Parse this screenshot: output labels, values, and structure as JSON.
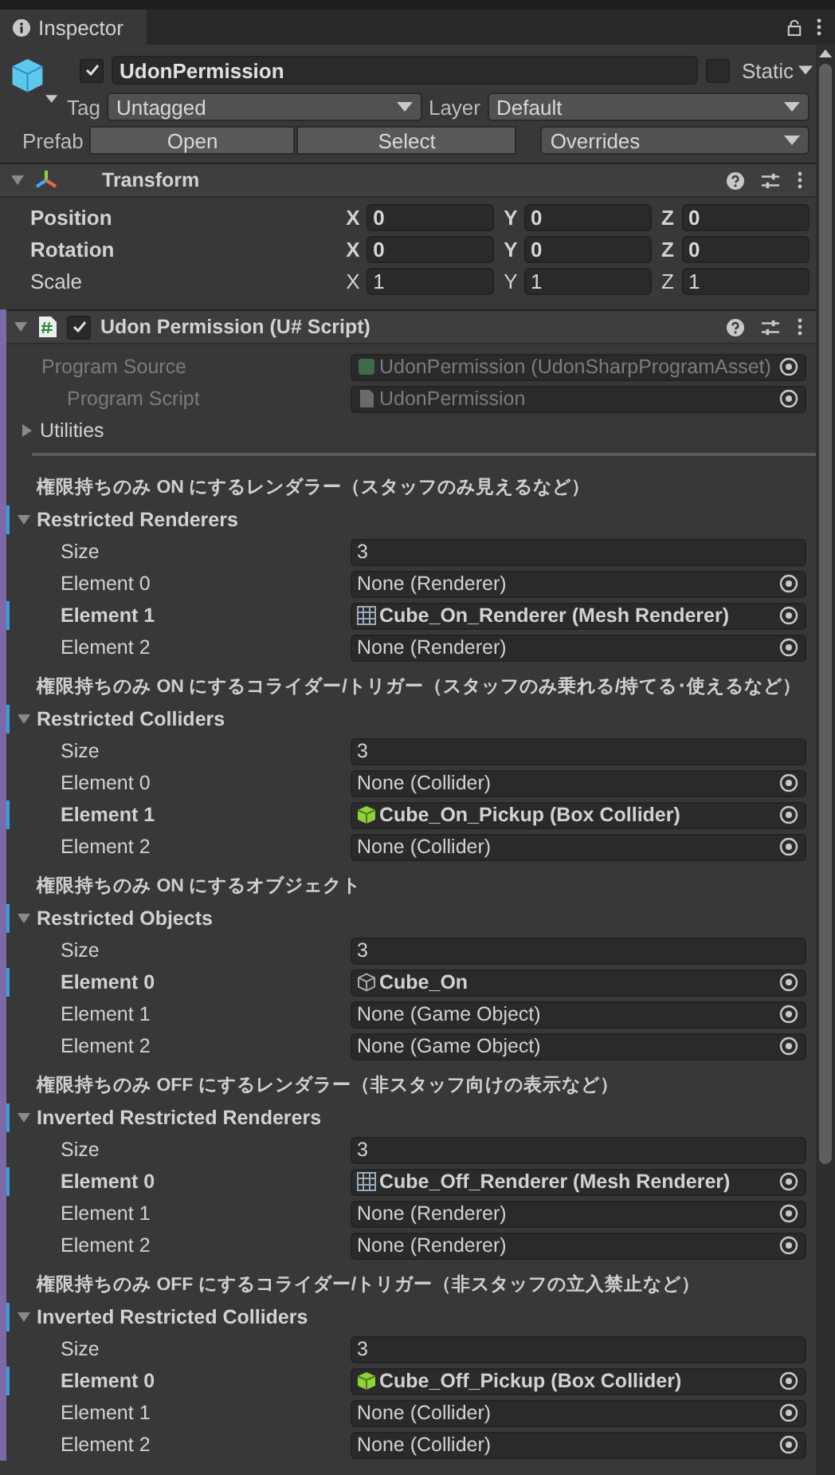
{
  "tab": {
    "title": "Inspector"
  },
  "object": {
    "enabled": true,
    "name": "UdonPermission",
    "static": false,
    "static_label": "Static",
    "tag_label": "Tag",
    "tag": "Untagged",
    "layer_label": "Layer",
    "layer": "Default",
    "prefab_label": "Prefab",
    "prefab_buttons": [
      "Open",
      "Select"
    ],
    "overrides": "Overrides"
  },
  "transform": {
    "title": "Transform",
    "expanded": true,
    "rows": [
      {
        "label": "Position",
        "modified": true,
        "values": [
          {
            "axis": "X",
            "value": "0"
          },
          {
            "axis": "Y",
            "value": "0"
          },
          {
            "axis": "Z",
            "value": "0"
          }
        ]
      },
      {
        "label": "Rotation",
        "modified": true,
        "values": [
          {
            "axis": "X",
            "value": "0"
          },
          {
            "axis": "Y",
            "value": "0"
          },
          {
            "axis": "Z",
            "value": "0"
          }
        ]
      },
      {
        "label": "Scale",
        "modified": false,
        "values": [
          {
            "axis": "X",
            "value": "1"
          },
          {
            "axis": "Y",
            "value": "1"
          },
          {
            "axis": "Z",
            "value": "1"
          }
        ]
      }
    ]
  },
  "script": {
    "title": "Udon Permission (U# Script)",
    "enabled": true,
    "expanded": true,
    "fields": [
      {
        "label": "Program Source",
        "value": "UdonPermission (UdonSharpProgramAsset)",
        "kind": "asset",
        "disabled": true,
        "children": [
          {
            "label": "Program Script",
            "value": "UdonPermission",
            "kind": "script",
            "disabled": true
          }
        ]
      }
    ],
    "utilities": {
      "label": "Utilities",
      "expanded": false
    }
  },
  "sections": [
    {
      "caption": "権限持ちのみ ON にするレンダラー（スタッフのみ見えるなど）",
      "title": "Restricted Renderers",
      "expanded": true,
      "modified": true,
      "size_label": "Size",
      "size": "3",
      "elements": [
        {
          "label": "Element 0",
          "value": "None (Renderer)",
          "kind": "none",
          "modified": false
        },
        {
          "label": "Element 1",
          "value": "Cube_On_Renderer (Mesh Renderer)",
          "kind": "mesh-renderer",
          "modified": true
        },
        {
          "label": "Element 2",
          "value": "None (Renderer)",
          "kind": "none",
          "modified": false
        }
      ]
    },
    {
      "caption": "権限持ちのみ ON にするコライダー/トリガー（スタッフのみ乗れる/持てる･使えるなど）",
      "title": "Restricted Colliders",
      "expanded": true,
      "modified": true,
      "size_label": "Size",
      "size": "3",
      "elements": [
        {
          "label": "Element 0",
          "value": "None (Collider)",
          "kind": "none",
          "modified": false
        },
        {
          "label": "Element 1",
          "value": "Cube_On_Pickup (Box Collider)",
          "kind": "box-collider",
          "modified": true
        },
        {
          "label": "Element 2",
          "value": "None (Collider)",
          "kind": "none",
          "modified": false
        }
      ]
    },
    {
      "caption": "権限持ちのみ ON にするオブジェクト",
      "title": "Restricted Objects",
      "expanded": true,
      "modified": true,
      "size_label": "Size",
      "size": "3",
      "elements": [
        {
          "label": "Element 0",
          "value": "Cube_On",
          "kind": "game-object",
          "modified": true
        },
        {
          "label": "Element 1",
          "value": "None (Game Object)",
          "kind": "none",
          "modified": false
        },
        {
          "label": "Element 2",
          "value": "None (Game Object)",
          "kind": "none",
          "modified": false
        }
      ]
    },
    {
      "caption": "権限持ちのみ OFF にするレンダラー（非スタッフ向けの表示など）",
      "title": "Inverted Restricted Renderers",
      "expanded": true,
      "modified": true,
      "size_label": "Size",
      "size": "3",
      "elements": [
        {
          "label": "Element 0",
          "value": "Cube_Off_Renderer (Mesh Renderer)",
          "kind": "mesh-renderer",
          "modified": true
        },
        {
          "label": "Element 1",
          "value": "None (Renderer)",
          "kind": "none",
          "modified": false
        },
        {
          "label": "Element 2",
          "value": "None (Renderer)",
          "kind": "none",
          "modified": false
        }
      ]
    },
    {
      "caption": "権限持ちのみ OFF にするコライダー/トリガー（非スタッフの立入禁止など）",
      "title": "Inverted Restricted Colliders",
      "expanded": true,
      "modified": true,
      "size_label": "Size",
      "size": "3",
      "elements": [
        {
          "label": "Element 0",
          "value": "Cube_Off_Pickup (Box Collider)",
          "kind": "box-collider",
          "modified": true
        },
        {
          "label": "Element 1",
          "value": "None (Collider)",
          "kind": "none",
          "modified": false
        },
        {
          "label": "Element 2",
          "value": "None (Collider)",
          "kind": "none",
          "modified": false
        }
      ]
    }
  ]
}
